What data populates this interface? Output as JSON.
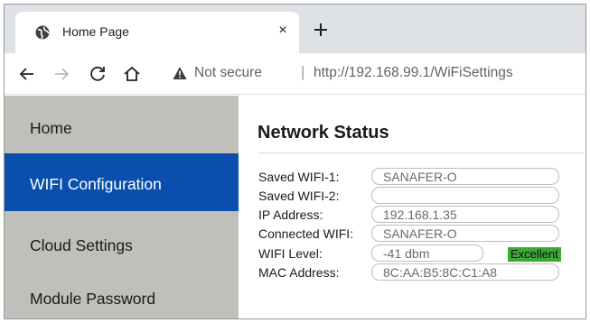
{
  "browser": {
    "tab_title": "Home Page",
    "tab_close": "×",
    "security_label": "Not secure",
    "separator": "|",
    "url": "http://192.168.99.1/WiFiSettings"
  },
  "sidebar": {
    "items": [
      {
        "label": "Home",
        "active": false
      },
      {
        "label": "WIFI Configuration",
        "active": true
      },
      {
        "label": "Cloud Settings",
        "active": false
      },
      {
        "label": "Module Password",
        "active": false
      }
    ]
  },
  "main": {
    "title": "Network Status",
    "fields": {
      "saved_wifi_1": {
        "label": "Saved WIFI-1:",
        "value": "SANAFER-O"
      },
      "saved_wifi_2": {
        "label": "Saved WIFI-2:",
        "value": ""
      },
      "ip_address": {
        "label": "IP Address:",
        "value": "192.168.1.35"
      },
      "connected_wifi": {
        "label": "Connected WIFI:",
        "value": "SANAFER-O"
      },
      "wifi_level": {
        "label": "WIFI Level:",
        "value": "-41 dbm",
        "quality": "Excellent"
      },
      "mac_address": {
        "label": "MAC Address:",
        "value": "8C:AA:B5:8C:C1:A8"
      }
    }
  },
  "colors": {
    "sidebar_bg": "#c0bfbc",
    "active_bg": "#0a4fad",
    "badge_bg": "#3aaa35"
  }
}
